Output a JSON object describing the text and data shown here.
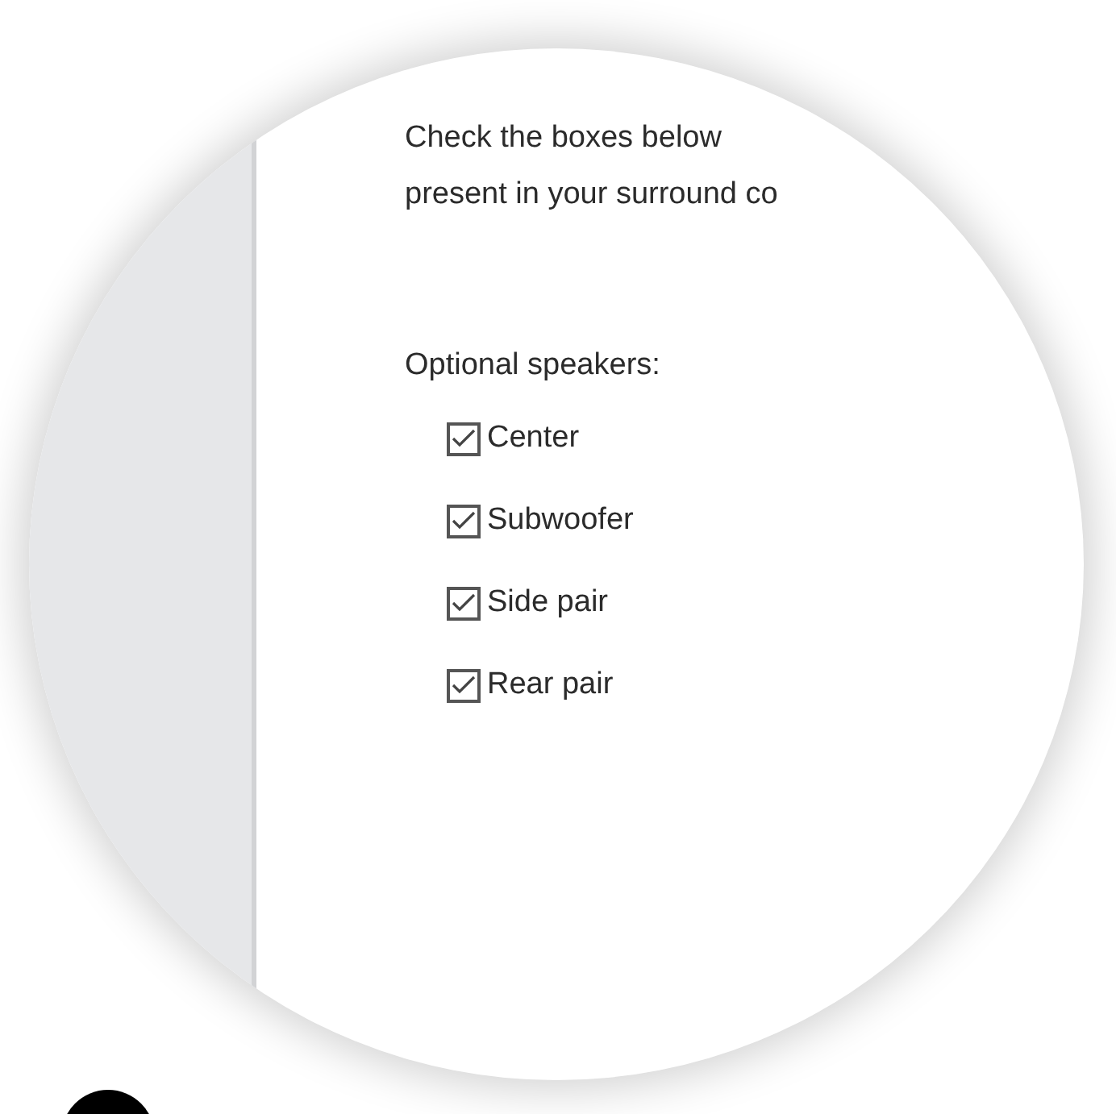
{
  "instructions": [
    "Check the boxes below",
    "present in your surround co"
  ],
  "optional_speakers": {
    "label": "Optional speakers:",
    "items": [
      {
        "label": "Center",
        "checked": true
      },
      {
        "label": "Subwoofer",
        "checked": true
      },
      {
        "label": "Side pair",
        "checked": true
      },
      {
        "label": "Rear pair",
        "checked": true
      }
    ]
  }
}
